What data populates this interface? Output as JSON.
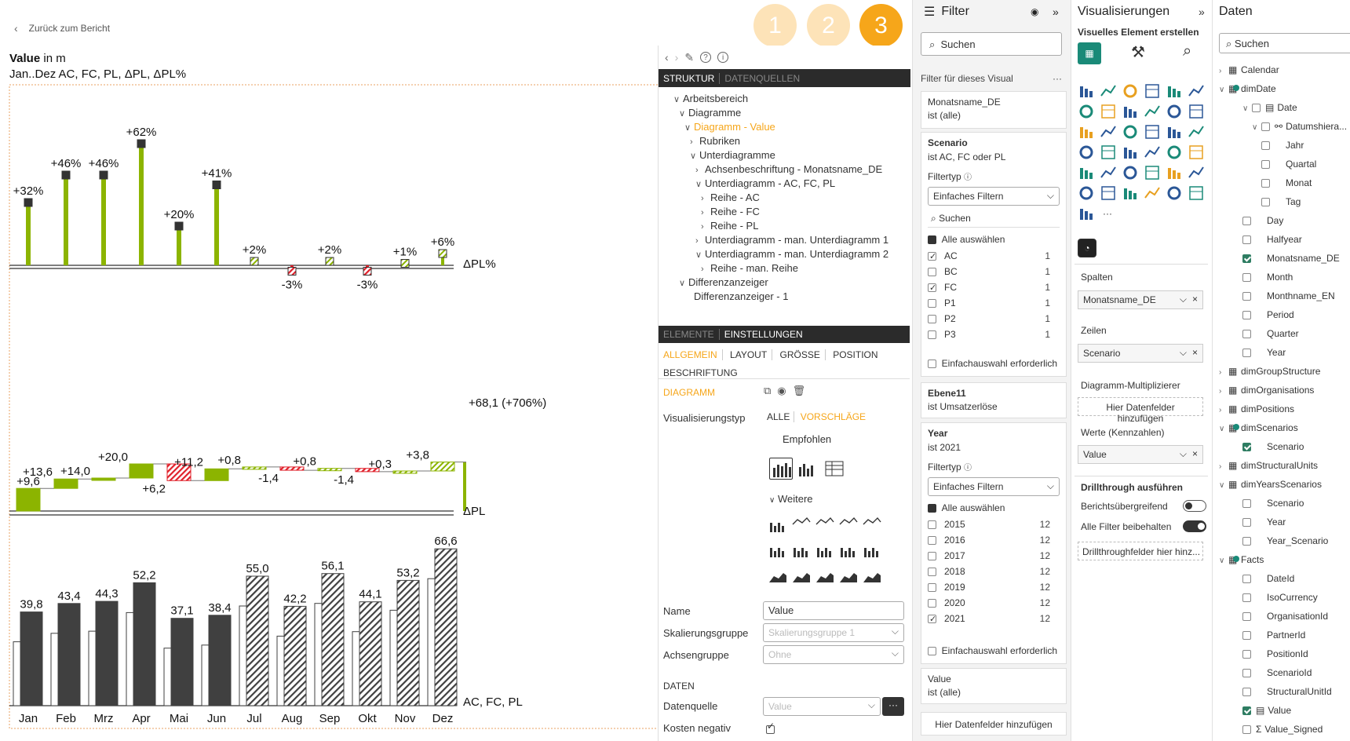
{
  "back_link": "Zurück zum Bericht",
  "steps": [
    "1",
    "2",
    "3"
  ],
  "chart": {
    "title_bold": "Value",
    "title_rest": " in m",
    "subtitle": "Jan..Dez AC, FC, PL, ΔPL, ΔPL%",
    "row_labels": {
      "pct": "ΔPL%",
      "delta": "ΔPL",
      "main": "AC, FC, PL"
    },
    "total_label": "+68,1 (+706%)"
  },
  "chart_data": {
    "type": "bar",
    "categories": [
      "Jan",
      "Feb",
      "Mrz",
      "Apr",
      "Mai",
      "Jun",
      "Jul",
      "Aug",
      "Sep",
      "Okt",
      "Nov",
      "Dez"
    ],
    "series": [
      {
        "name": "AC, FC",
        "values": [
          39.8,
          43.4,
          44.3,
          52.2,
          37.1,
          38.4,
          55.0,
          42.2,
          56.1,
          44.1,
          53.2,
          66.6
        ]
      },
      {
        "name": "ΔPL",
        "values": [
          9.6,
          4.0,
          0.4,
          6.0,
          -7.1,
          5.0,
          0.8,
          -1.4,
          0.8,
          -1.4,
          0.3,
          3.8
        ]
      },
      {
        "name": "ΔPL%",
        "values": [
          32,
          46,
          46,
          62,
          20,
          41,
          2,
          -3,
          2,
          -3,
          1,
          6
        ]
      }
    ],
    "value_labels": [
      "39,8",
      "43,4",
      "44,3",
      "52,2",
      "37,1",
      "38,4",
      "55,0",
      "42,2",
      "56,1",
      "44,1",
      "53,2",
      "66,6"
    ],
    "delta_labels": [
      "+9,6",
      "+13,6",
      "+14,0",
      "+20,0",
      "+6,2",
      "+11,2",
      "+0,8",
      "-1,4",
      "+0,8",
      "-1,4",
      "+0,3",
      "+3,8"
    ],
    "pct_labels": [
      "+32%",
      "+46%",
      "+46%",
      "+62%",
      "+20%",
      "+41%",
      "+2%",
      "-3%",
      "+2%",
      "-3%",
      "+1%",
      "+6%"
    ],
    "actual_months": 6,
    "colors": {
      "positive": "#8cb400",
      "negative": "#e0202a",
      "actual": "#404040"
    }
  },
  "editor": {
    "tabs_top": [
      "STRUKTUR",
      "DATENQUELLEN"
    ],
    "tree": [
      {
        "label": "Arbeitsbereich",
        "indent": 0,
        "arrow": "v"
      },
      {
        "label": "Diagramme",
        "indent": 1,
        "arrow": "v"
      },
      {
        "label": "Diagramm - Value",
        "indent": 2,
        "arrow": "v",
        "active": true
      },
      {
        "label": "Rubriken",
        "indent": 3,
        "arrow": ">"
      },
      {
        "label": "Unterdiagramme",
        "indent": 3,
        "arrow": "v"
      },
      {
        "label": "Achsenbeschriftung - Monatsname_DE",
        "indent": 4,
        "arrow": ">"
      },
      {
        "label": "Unterdiagramm - AC, FC, PL",
        "indent": 4,
        "arrow": "v"
      },
      {
        "label": "Reihe - AC",
        "indent": 5,
        "arrow": ">"
      },
      {
        "label": "Reihe - FC",
        "indent": 5,
        "arrow": ">"
      },
      {
        "label": "Reihe - PL",
        "indent": 5,
        "arrow": ">"
      },
      {
        "label": "Unterdiagramm - man. Unterdiagramm 1",
        "indent": 4,
        "arrow": ">"
      },
      {
        "label": "Unterdiagramm - man. Unterdiagramm 2",
        "indent": 4,
        "arrow": "v"
      },
      {
        "label": "Reihe - man. Reihe",
        "indent": 5,
        "arrow": ">"
      },
      {
        "label": "Differenzanzeiger",
        "indent": 1,
        "arrow": "v"
      },
      {
        "label": "Differenzanzeiger - 1",
        "indent": 2,
        "arrow": ""
      }
    ],
    "tabs_mid": [
      "ELEMENTE",
      "EINSTELLUNGEN"
    ],
    "subtabs": [
      "ALLGEMEIN",
      "LAYOUT",
      "GRÖSSE",
      "POSITION",
      "BESCHRIFTUNG"
    ],
    "section_diagram": "DIAGRAMM",
    "vis_type_label": "Visualisierungstyp",
    "vis_tabs": [
      "ALLE",
      "VORSCHLÄGE"
    ],
    "recommended": "Empfohlen",
    "more": "Weitere",
    "name_label": "Name",
    "name_value": "Value",
    "scale_label": "Skalierungsgruppe",
    "scale_placeholder": "Skalierungsgruppe 1",
    "axis_label": "Achsengruppe",
    "axis_placeholder": "Ohne",
    "data_section": "DATEN",
    "source_label": "Datenquelle",
    "source_placeholder": "Value",
    "cost_label": "Kosten negativ"
  },
  "filter": {
    "title": "Filter",
    "search": "Suchen",
    "visual_header": "Filter für dieses Visual",
    "card1_title": "Monatsname_DE",
    "card1_sub": "ist (alle)",
    "scenario_title": "Scenario",
    "scenario_sub": "ist AC, FC oder PL",
    "filtertyp": "Filtertyp",
    "filter_mode": "Einfaches Filtern",
    "search2": "Suchen",
    "select_all": "Alle auswählen",
    "scenario_items": [
      {
        "label": "AC",
        "count": "1",
        "checked": true
      },
      {
        "label": "BC",
        "count": "1",
        "checked": false
      },
      {
        "label": "FC",
        "count": "1",
        "checked": true
      },
      {
        "label": "P1",
        "count": "1",
        "checked": false
      },
      {
        "label": "P2",
        "count": "1",
        "checked": false
      },
      {
        "label": "P3",
        "count": "1",
        "checked": false
      }
    ],
    "single_select": "Einfachauswahl erforderlich",
    "ebene_title": "Ebene11",
    "ebene_sub": "ist Umsatzerlöse",
    "year_title": "Year",
    "year_sub": "ist 2021",
    "year_items": [
      {
        "label": "2015",
        "count": "12",
        "checked": false
      },
      {
        "label": "2016",
        "count": "12",
        "checked": false
      },
      {
        "label": "2017",
        "count": "12",
        "checked": false
      },
      {
        "label": "2018",
        "count": "12",
        "checked": false
      },
      {
        "label": "2019",
        "count": "12",
        "checked": false
      },
      {
        "label": "2020",
        "count": "12",
        "checked": false
      },
      {
        "label": "2021",
        "count": "12",
        "checked": true
      }
    ],
    "value_title": "Value",
    "value_sub": "ist (alle)",
    "add_fields": "Hier Datenfelder hinzufügen"
  },
  "vis": {
    "title": "Visualisierungen",
    "subtitle": "Visuelles Element erstellen",
    "columns_label": "Spalten",
    "columns_value": "Monatsname_DE",
    "rows_label": "Zeilen",
    "rows_value": "Scenario",
    "multiplier_label": "Diagramm-Multiplizierer",
    "multiplier_add": "Hier Datenfelder hinzufügen",
    "values_label": "Werte (Kennzahlen)",
    "values_value": "Value",
    "drill_title": "Drillthrough ausführen",
    "drill_cross": "Berichtsübergreifend",
    "drill_keep": "Alle Filter beibehalten",
    "drill_add": "Drillthroughfelder hier hinz..."
  },
  "data_pane": {
    "title": "Daten",
    "search": "Suchen",
    "items": [
      {
        "label": "Calendar",
        "indent": 0,
        "kind": "table",
        "arrow": ">"
      },
      {
        "label": "dimDate",
        "indent": 0,
        "kind": "table",
        "arrow": "v",
        "mark": true
      },
      {
        "label": "Date",
        "indent": 1,
        "kind": "cal",
        "arrow": "v",
        "chk": false
      },
      {
        "label": "Datumshiera...",
        "indent": 2,
        "kind": "hier",
        "arrow": "v",
        "chk": false
      },
      {
        "label": "Jahr",
        "indent": 3,
        "kind": "field",
        "chk": false
      },
      {
        "label": "Quartal",
        "indent": 3,
        "kind": "field",
        "chk": false
      },
      {
        "label": "Monat",
        "indent": 3,
        "kind": "field",
        "chk": false
      },
      {
        "label": "Tag",
        "indent": 3,
        "kind": "field",
        "chk": false
      },
      {
        "label": "Day",
        "indent": 1,
        "kind": "field",
        "chk": false
      },
      {
        "label": "Halfyear",
        "indent": 1,
        "kind": "field",
        "chk": false
      },
      {
        "label": "Monatsname_DE",
        "indent": 1,
        "kind": "field",
        "chk": true
      },
      {
        "label": "Month",
        "indent": 1,
        "kind": "field",
        "chk": false
      },
      {
        "label": "Monthname_EN",
        "indent": 1,
        "kind": "field",
        "chk": false
      },
      {
        "label": "Period",
        "indent": 1,
        "kind": "field",
        "chk": false
      },
      {
        "label": "Quarter",
        "indent": 1,
        "kind": "field",
        "chk": false
      },
      {
        "label": "Year",
        "indent": 1,
        "kind": "field",
        "chk": false
      },
      {
        "label": "dimGroupStructure",
        "indent": 0,
        "kind": "table",
        "arrow": ">"
      },
      {
        "label": "dimOrganisations",
        "indent": 0,
        "kind": "table",
        "arrow": ">"
      },
      {
        "label": "dimPositions",
        "indent": 0,
        "kind": "table",
        "arrow": ">"
      },
      {
        "label": "dimScenarios",
        "indent": 0,
        "kind": "table",
        "arrow": "v",
        "mark": true
      },
      {
        "label": "Scenario",
        "indent": 1,
        "kind": "field",
        "chk": true
      },
      {
        "label": "dimStructuralUnits",
        "indent": 0,
        "kind": "table",
        "arrow": ">"
      },
      {
        "label": "dimYearsScenarios",
        "indent": 0,
        "kind": "table",
        "arrow": "v"
      },
      {
        "label": "Scenario",
        "indent": 1,
        "kind": "field",
        "chk": false
      },
      {
        "label": "Year",
        "indent": 1,
        "kind": "field",
        "chk": false
      },
      {
        "label": "Year_Scenario",
        "indent": 1,
        "kind": "field",
        "chk": false
      },
      {
        "label": "Facts",
        "indent": 0,
        "kind": "table",
        "arrow": "v",
        "mark": true
      },
      {
        "label": "DateId",
        "indent": 1,
        "kind": "field",
        "chk": false
      },
      {
        "label": "IsoCurrency",
        "indent": 1,
        "kind": "field",
        "chk": false
      },
      {
        "label": "OrganisationId",
        "indent": 1,
        "kind": "field",
        "chk": false
      },
      {
        "label": "PartnerId",
        "indent": 1,
        "kind": "field",
        "chk": false
      },
      {
        "label": "PositionId",
        "indent": 1,
        "kind": "field",
        "chk": false
      },
      {
        "label": "ScenarioId",
        "indent": 1,
        "kind": "field",
        "chk": false
      },
      {
        "label": "StructuralUnitId",
        "indent": 1,
        "kind": "field",
        "chk": false
      },
      {
        "label": "Value",
        "indent": 1,
        "kind": "calc",
        "chk": true
      },
      {
        "label": "Value_Signed",
        "indent": 1,
        "kind": "sigma",
        "chk": false
      }
    ]
  }
}
